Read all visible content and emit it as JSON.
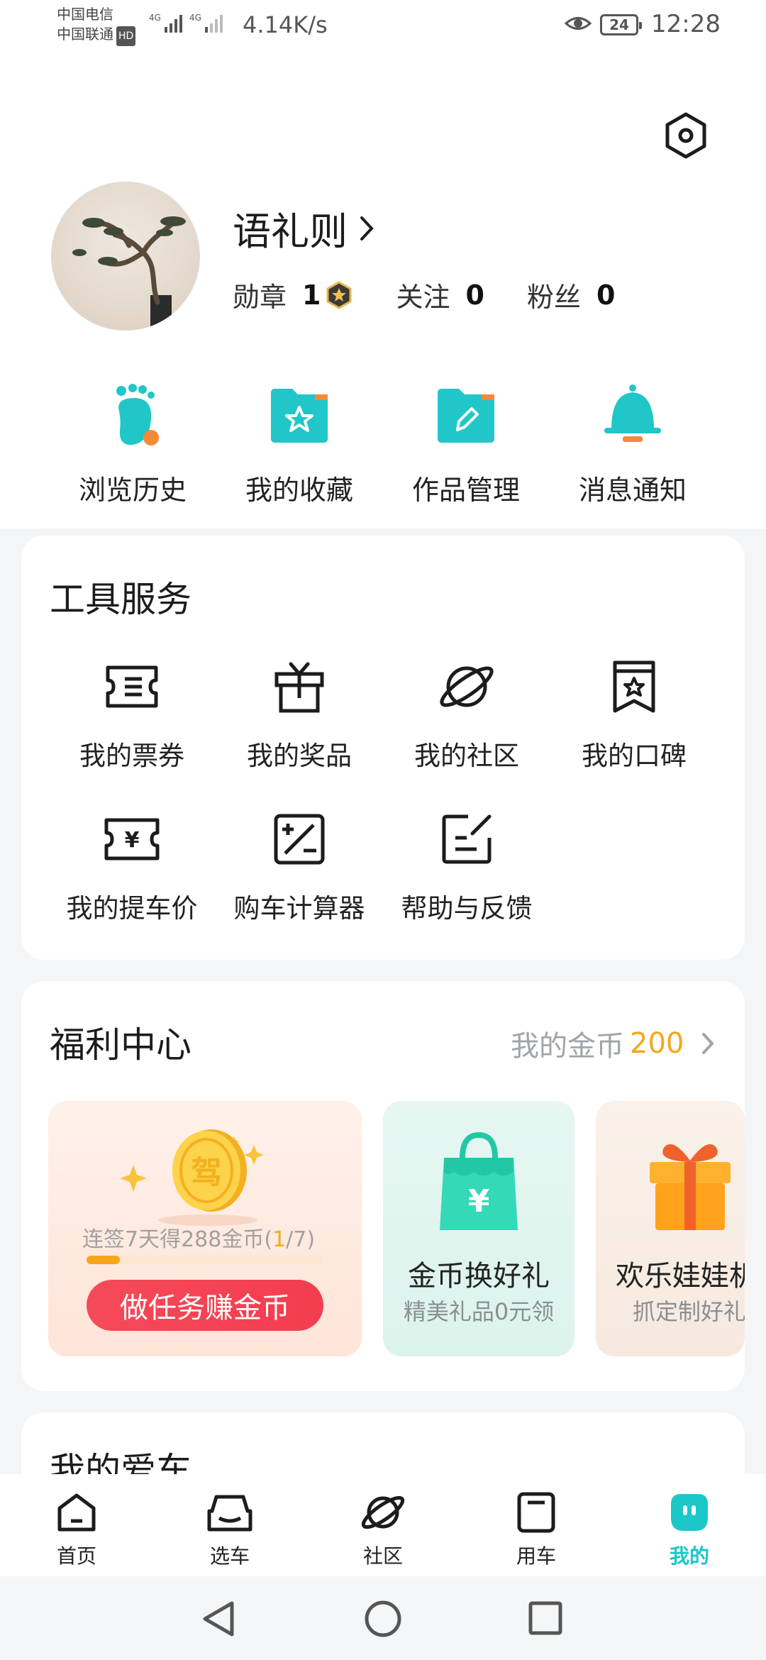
{
  "status_bar": {
    "carrier1": "中国电信",
    "carrier2": "中国联通",
    "hd": "HD",
    "net1": "4G",
    "net2": "4G",
    "speed": "4.14K/s",
    "battery": "24",
    "time": "12:28"
  },
  "profile": {
    "name": "语礼则",
    "medal_label": "勋章",
    "medal_count": "1",
    "follow_label": "关注",
    "follow_count": "0",
    "fans_label": "粉丝",
    "fans_count": "0"
  },
  "quick_actions": [
    {
      "label": "浏览历史",
      "icon": "footprint-icon"
    },
    {
      "label": "我的收藏",
      "icon": "star-folder-icon"
    },
    {
      "label": "作品管理",
      "icon": "edit-folder-icon"
    },
    {
      "label": "消息通知",
      "icon": "bell-icon"
    }
  ],
  "tools": {
    "title": "工具服务",
    "items": [
      {
        "label": "我的票券",
        "icon": "ticket-icon"
      },
      {
        "label": "我的奖品",
        "icon": "gift-icon"
      },
      {
        "label": "我的社区",
        "icon": "planet-icon"
      },
      {
        "label": "我的口碑",
        "icon": "bookmark-star-icon"
      },
      {
        "label": "我的提车价",
        "icon": "yuan-ticket-icon"
      },
      {
        "label": "购车计算器",
        "icon": "calculator-icon"
      },
      {
        "label": "帮助与反馈",
        "icon": "feedback-icon"
      }
    ]
  },
  "welfare": {
    "title": "福利中心",
    "coins_label": "我的金币",
    "coins_value": "200",
    "coin_glyph": "驾",
    "checkin_prefix": "连签7天得288金币(",
    "checkin_progress": "1",
    "checkin_suffix": "/7)",
    "checkin_fraction": 0.14,
    "task_button": "做任务赚金币",
    "bag_glyph": "¥",
    "exchange_title": "金币换好礼",
    "exchange_sub": "精美礼品0元领",
    "doll_title": "欢乐娃娃机",
    "doll_sub": "抓定制好礼"
  },
  "my_car": {
    "title": "我的爱车"
  },
  "bottom_nav": [
    {
      "label": "首页",
      "icon": "home-icon",
      "active": false
    },
    {
      "label": "选车",
      "icon": "car-front-icon",
      "active": false
    },
    {
      "label": "社区",
      "icon": "planet-icon",
      "active": false
    },
    {
      "label": "用车",
      "icon": "car-box-icon",
      "active": false
    },
    {
      "label": "我的",
      "icon": "mine-face-icon",
      "active": true
    }
  ],
  "colors": {
    "accent": "#1bc7c9",
    "coin": "#f4a81c",
    "task_button": "#f33d4f"
  }
}
